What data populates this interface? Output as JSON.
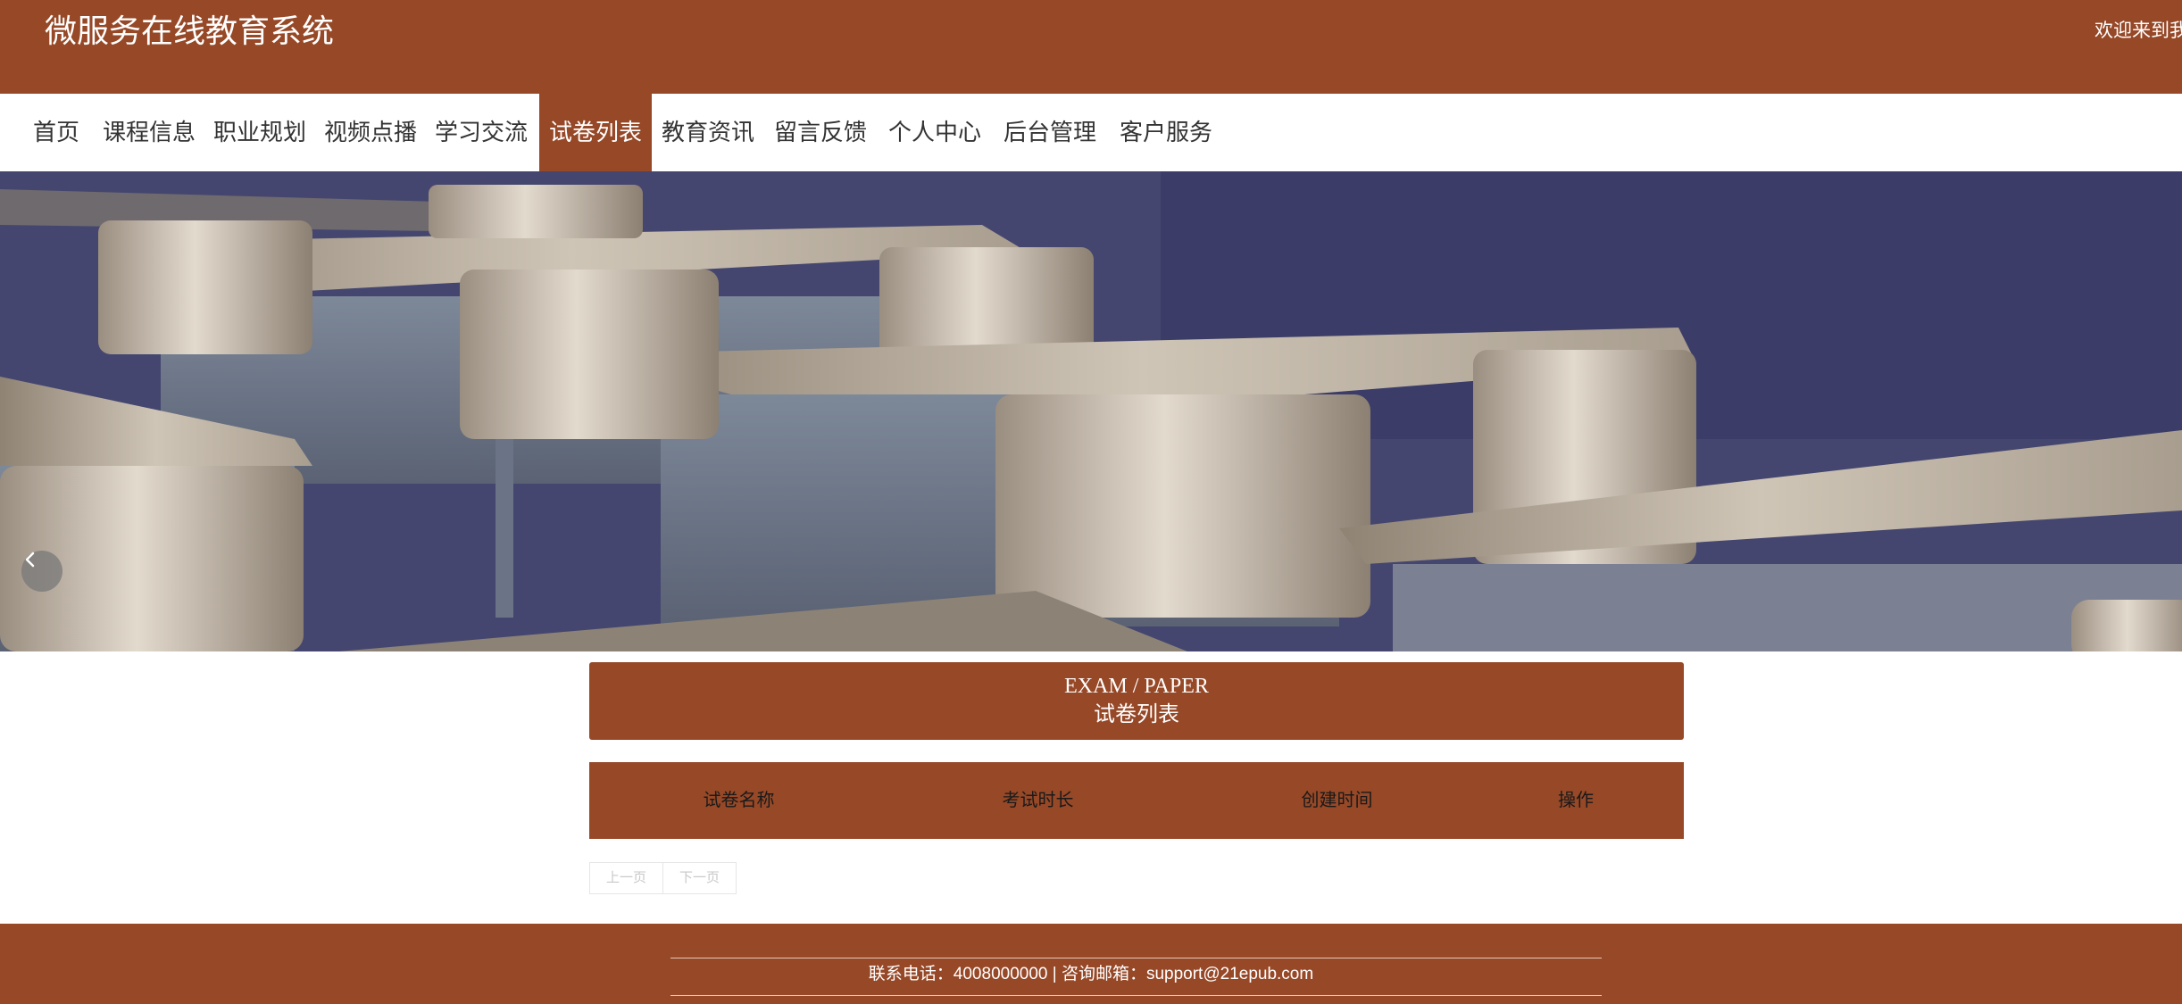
{
  "header": {
    "site_title": "微服务在线教育系统",
    "welcome_text": "欢迎来到我"
  },
  "nav": {
    "items": [
      {
        "label": "首页"
      },
      {
        "label": "课程信息"
      },
      {
        "label": "职业规划"
      },
      {
        "label": "视频点播"
      },
      {
        "label": "学习交流"
      },
      {
        "label": "试卷列表",
        "active": true
      },
      {
        "label": "教育资讯"
      },
      {
        "label": "留言反馈"
      },
      {
        "label": "个人中心"
      },
      {
        "label": "后台管理"
      },
      {
        "label": "客户服务"
      }
    ]
  },
  "banner": {
    "image_subject": "classroom-desks-illustration",
    "prev_icon": "chevron-left-icon",
    "slides": 3,
    "active_slide": 1
  },
  "section": {
    "title_en": "EXAM / PAPER",
    "title_cn": "试卷列表"
  },
  "table": {
    "columns": [
      "试卷名称",
      "考试时长",
      "创建时间",
      "操作"
    ],
    "rows": []
  },
  "pager": {
    "prev_label": "上一页",
    "next_label": "下一页"
  },
  "footer": {
    "contact": "联系电话：4008000000 | 咨询邮箱：support@21epub.com"
  },
  "colors": {
    "brand": "#964827",
    "active_dot": "#c0532c",
    "nav_text": "#333333"
  }
}
